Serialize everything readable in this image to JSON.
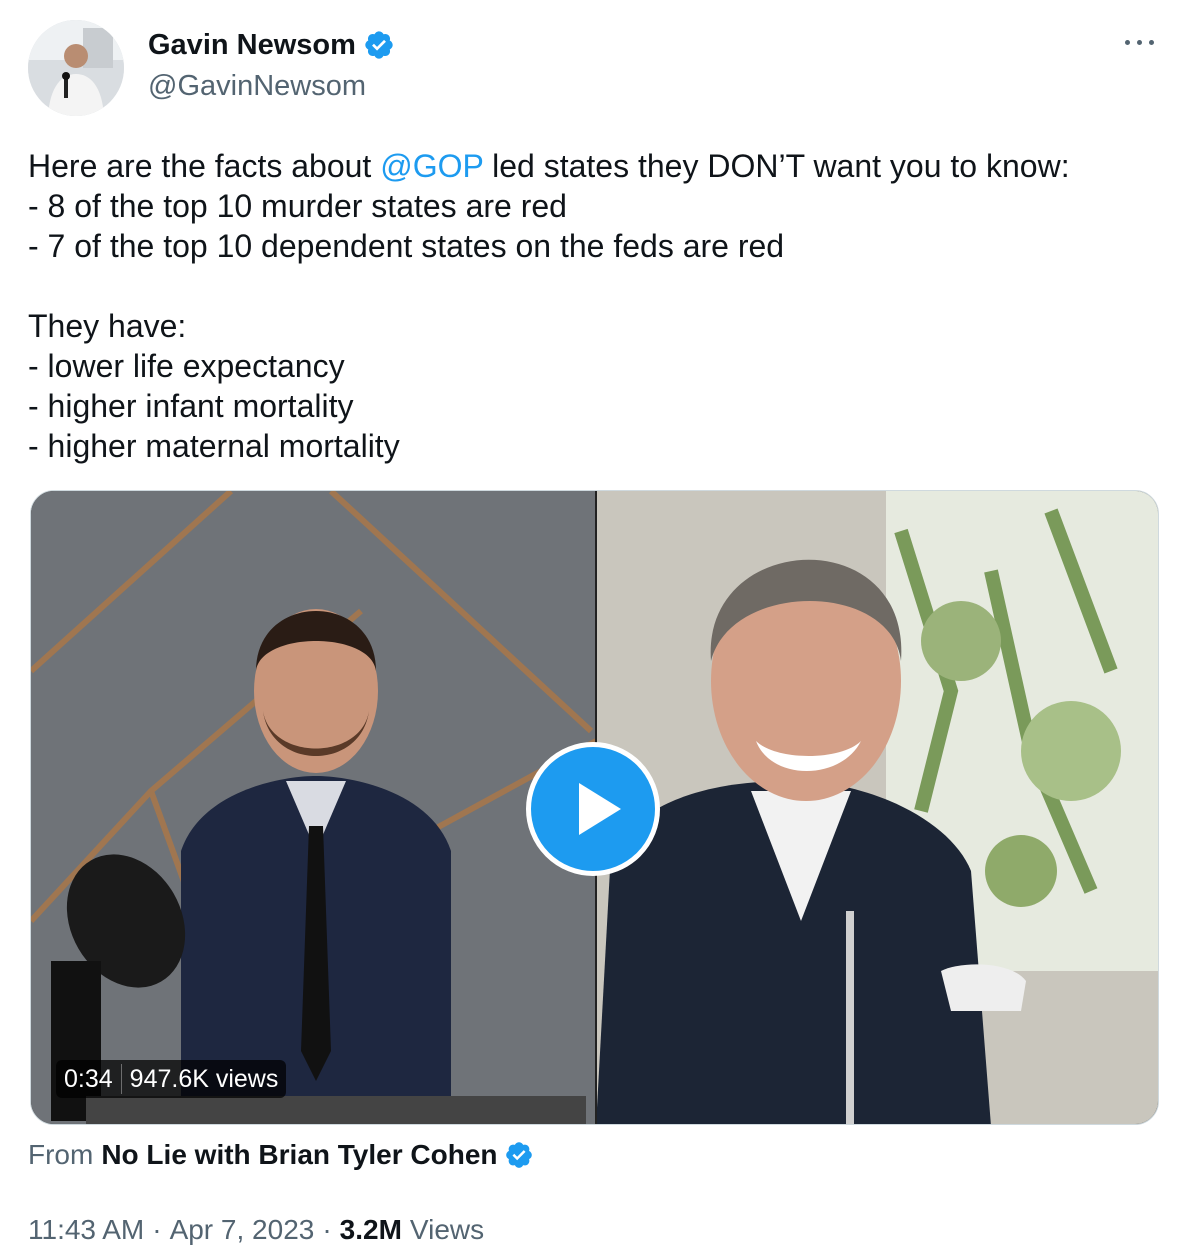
{
  "author": {
    "display_name": "Gavin Newsom",
    "handle": "@GavinNewsom",
    "verified": true,
    "avatar_icon": "profile-photo"
  },
  "more_icon": "more-options-icon",
  "tweet": {
    "lines": [
      {
        "pre": "Here are the facts about ",
        "mention": "@GOP",
        "post": " led states they DON’T want you to know:"
      },
      {
        "text": "- 8 of the top 10 murder states are red"
      },
      {
        "text": "- 7 of the top 10 dependent states on the feds are red"
      },
      {
        "text": ""
      },
      {
        "text": "They have:"
      },
      {
        "text": "- lower life expectancy"
      },
      {
        "text": "- higher infant mortality"
      },
      {
        "text": "- higher maternal mortality"
      }
    ]
  },
  "video": {
    "duration": "0:34",
    "views": "947.6K views",
    "play_icon": "play-icon"
  },
  "source": {
    "from_label": "From",
    "name": "No Lie with Brian Tyler Cohen",
    "verified": true
  },
  "meta": {
    "time": "11:43 AM",
    "date": "Apr 7, 2023",
    "views_count": "3.2M",
    "views_label": "Views"
  },
  "colors": {
    "accent": "#1d9bf0",
    "text": "#0f1419",
    "secondary": "#536471"
  }
}
